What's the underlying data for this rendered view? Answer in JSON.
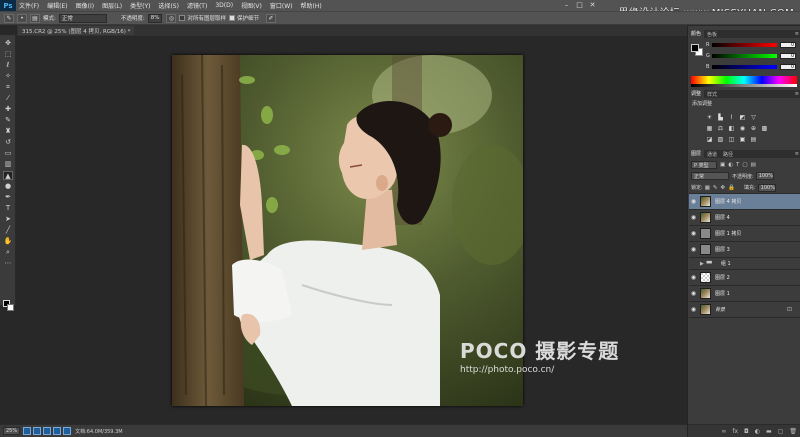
{
  "app": {
    "logo": "Ps",
    "menu": [
      "文件(F)",
      "编辑(E)",
      "图像(I)",
      "图层(L)",
      "类型(Y)",
      "选择(S)",
      "滤镜(T)",
      "3D(D)",
      "视图(V)",
      "窗口(W)",
      "帮助(H)"
    ],
    "watermark_site": "思缘设计论坛 www.MISSYUAN.COM",
    "window_controls": [
      "–",
      "□",
      "✕"
    ]
  },
  "options": {
    "mode_label": "模式:",
    "mode_value": "正常",
    "opacity_label": "不透明度:",
    "opacity_value": "8%",
    "check1_label": "对所有图层取样",
    "check2_label": "保护细节"
  },
  "document": {
    "tab_title": "315.CR2 @ 25% (图层 4 拷贝, RGB/16) *",
    "status_zoom": "25%",
    "status_info": "文档:64.0M/359.3M"
  },
  "photo_watermark": {
    "big": "POCO 摄影专题",
    "small": "http://photo.poco.cn/"
  },
  "color_panel": {
    "tabs": [
      "颜色",
      "色板"
    ],
    "channels": [
      {
        "label": "R",
        "value": "0"
      },
      {
        "label": "G",
        "value": "0"
      },
      {
        "label": "B",
        "value": "0"
      }
    ]
  },
  "adjust_panel": {
    "tabs": [
      "调整",
      "样式"
    ],
    "title": "添加调整"
  },
  "layers_panel": {
    "tabs": [
      "图层",
      "通道",
      "路径"
    ],
    "kind_label": "P 类型",
    "blend_mode": "正常",
    "opacity_label": "不透明度:",
    "opacity_value": "100%",
    "lock_label": "锁定:",
    "fill_label": "填充:",
    "fill_value": "100%",
    "layers": [
      {
        "name": "图层 4 拷贝",
        "thumb": "photo",
        "visible": true,
        "selected": true
      },
      {
        "name": "图层 4",
        "thumb": "photo",
        "visible": true,
        "selected": false
      },
      {
        "name": "图层 1 拷贝",
        "thumb": "gray",
        "visible": true,
        "selected": false
      },
      {
        "name": "图层 3",
        "thumb": "gray",
        "visible": true,
        "selected": false
      },
      {
        "name": "组 1",
        "thumb": "folder",
        "visible": false,
        "selected": false
      },
      {
        "name": "图层 2",
        "thumb": "checker",
        "visible": true,
        "selected": false
      },
      {
        "name": "图层 1",
        "thumb": "photo",
        "visible": true,
        "selected": false
      },
      {
        "name": "背景",
        "thumb": "photo",
        "visible": true,
        "selected": false,
        "locked": true
      }
    ]
  }
}
